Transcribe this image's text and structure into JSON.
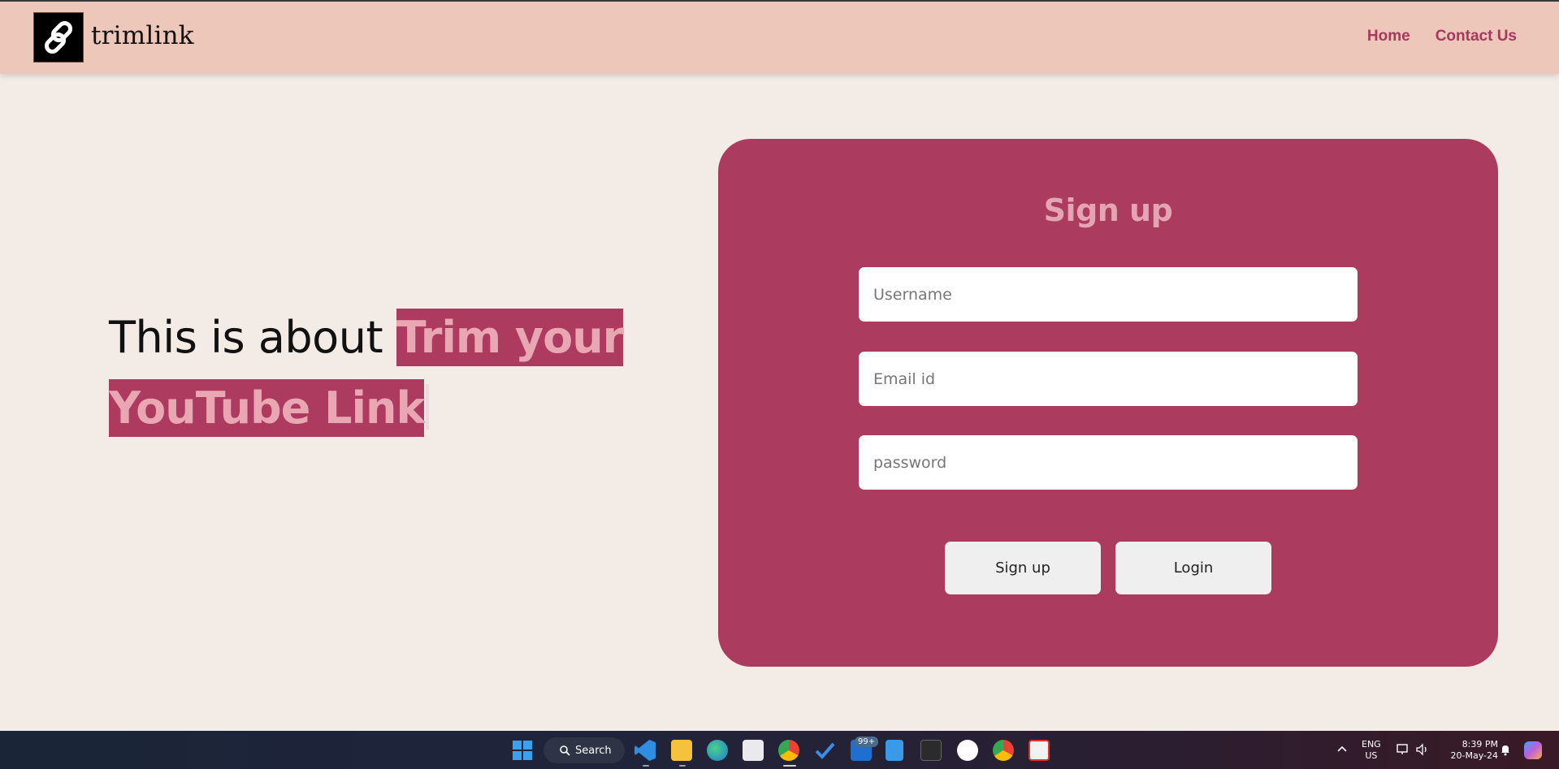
{
  "app": {
    "brand": "trimlink"
  },
  "nav": {
    "home": "Home",
    "contact": "Contact Us"
  },
  "hero": {
    "plain": "This is about ",
    "highlight_line1": "Trim your",
    "highlight_line2": "YouTube Link"
  },
  "signup": {
    "title": "Sign up",
    "username_placeholder": "Username",
    "email_placeholder": "Email id",
    "password_placeholder": "password",
    "signup_button": "Sign up",
    "login_button": "Login"
  },
  "taskbar": {
    "search_label": "Search",
    "mail_badge": "99+",
    "lang_line1": "ENG",
    "lang_line2": "US",
    "time": "8:39 PM",
    "date": "20-May-24"
  },
  "colors": {
    "header_bg": "#edc7b9",
    "page_bg": "#f3ebe6",
    "accent": "#ab3b5f",
    "accent_text": "#e4a4b4",
    "nav_link": "#a8385e"
  }
}
